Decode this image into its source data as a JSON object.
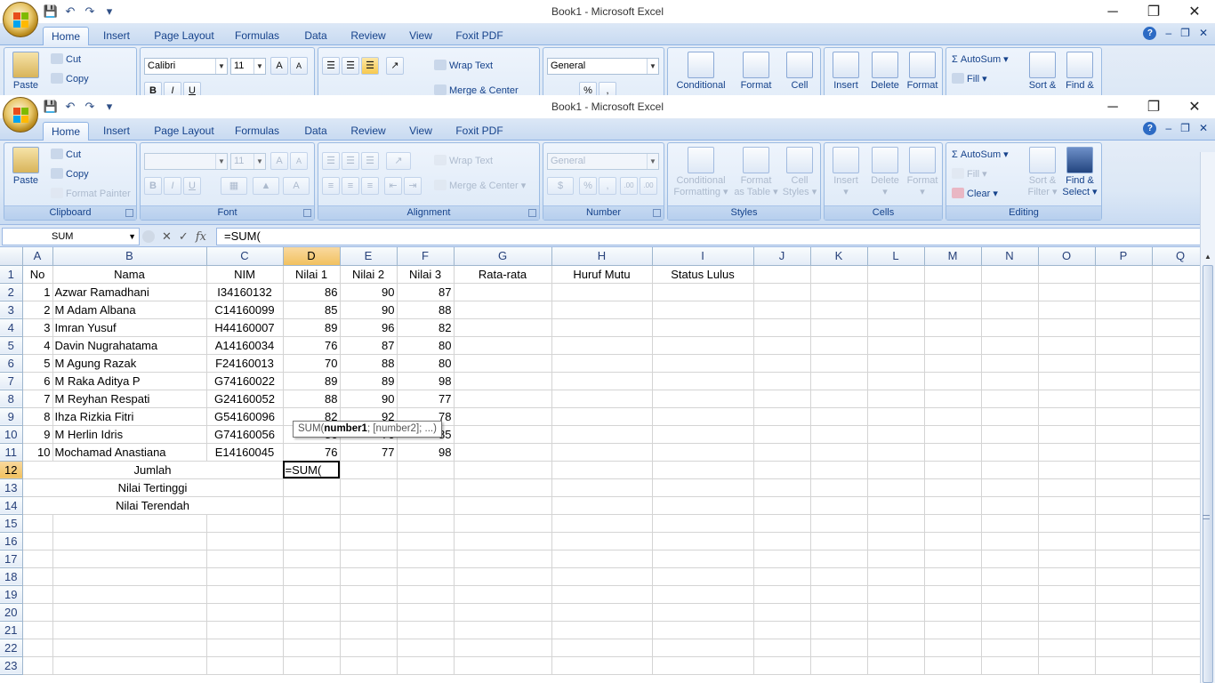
{
  "app": {
    "title": "Book1 - Microsoft Excel",
    "window_controls": {
      "minimize": "─",
      "restore": "❐",
      "close": "✕"
    }
  },
  "tabs": [
    "Home",
    "Insert",
    "Page Layout",
    "Formulas",
    "Data",
    "Review",
    "View",
    "Foxit PDF"
  ],
  "ribbon": {
    "clipboard": {
      "paste": "Paste",
      "cut": "Cut",
      "copy": "Copy",
      "format_painter": "Format Painter",
      "label": "Clipboard"
    },
    "font": {
      "name": "Calibri",
      "size": "11",
      "grow": "A",
      "shrink": "A",
      "bold": "B",
      "italic": "I",
      "underline": "U",
      "label": "Font"
    },
    "alignment": {
      "wrap_text": "Wrap Text",
      "merge_center": "Merge & Center",
      "label": "Alignment"
    },
    "number": {
      "format": "General",
      "percent": "%",
      "comma": ",",
      "inc_dec": ".00",
      "label": "Number"
    },
    "styles": {
      "conditional": "Conditional",
      "conditional2": "Formatting",
      "format_table": "Format",
      "format_table2": "as Table",
      "cell_styles": "Cell",
      "cell_styles2": "Styles",
      "label": "Styles"
    },
    "cells": {
      "insert": "Insert",
      "delete": "Delete",
      "format": "Format",
      "label": "Cells"
    },
    "editing": {
      "autosum": "AutoSum",
      "fill": "Fill",
      "clear": "Clear",
      "sort": "Sort &",
      "sort2": "Filter",
      "find": "Find &",
      "find2": "Select",
      "label": "Editing"
    }
  },
  "formula_bar": {
    "name_box": "SUM",
    "fx": "fx",
    "formula": "=SUM("
  },
  "columns": [
    "A",
    "B",
    "C",
    "D",
    "E",
    "F",
    "G",
    "H",
    "I",
    "J",
    "K",
    "L",
    "M",
    "N",
    "O",
    "P",
    "Q"
  ],
  "headers": {
    "no": "No",
    "nama": "Nama",
    "nim": "NIM",
    "n1": "Nilai 1",
    "n2": "Nilai 2",
    "n3": "Nilai 3",
    "rata": "Rata-rata",
    "huruf": "Huruf Mutu",
    "status": "Status Lulus"
  },
  "students": [
    {
      "no": "1",
      "nama": "Azwar Ramadhani",
      "nim": "I34160132",
      "n1": "86",
      "n2": "90",
      "n3": "87"
    },
    {
      "no": "2",
      "nama": "M Adam Albana",
      "nim": "C14160099",
      "n1": "85",
      "n2": "90",
      "n3": "88"
    },
    {
      "no": "3",
      "nama": "Imran Yusuf",
      "nim": "H44160007",
      "n1": "89",
      "n2": "96",
      "n3": "82"
    },
    {
      "no": "4",
      "nama": "Davin Nugrahatama",
      "nim": "A14160034",
      "n1": "76",
      "n2": "87",
      "n3": "80"
    },
    {
      "no": "5",
      "nama": "M Agung Razak",
      "nim": "F24160013",
      "n1": "70",
      "n2": "88",
      "n3": "80"
    },
    {
      "no": "6",
      "nama": "M Raka Aditya P",
      "nim": "G74160022",
      "n1": "89",
      "n2": "89",
      "n3": "98"
    },
    {
      "no": "7",
      "nama": "M Reyhan Respati",
      "nim": "G24160052",
      "n1": "88",
      "n2": "90",
      "n3": "77"
    },
    {
      "no": "8",
      "nama": "Ihza Rizkia Fitri",
      "nim": "G54160096",
      "n1": "82",
      "n2": "92",
      "n3": "78"
    },
    {
      "no": "9",
      "nama": "M Herlin Idris",
      "nim": "G74160056",
      "n1": "86",
      "n2": "76",
      "n3": "85"
    },
    {
      "no": "10",
      "nama": "Mochamad Anastiana",
      "nim": "E14160045",
      "n1": "76",
      "n2": "77",
      "n3": "98"
    }
  ],
  "summary": {
    "jumlah": "Jumlah",
    "tertinggi": "Nilai Tertinggi",
    "terendah": "Nilai Terendah",
    "active_cell_value": "=SUM("
  },
  "tooltip": {
    "prefix": "SUM(",
    "bold": "number1",
    "suffix": "; [number2]; ...)"
  },
  "row_count": 23
}
